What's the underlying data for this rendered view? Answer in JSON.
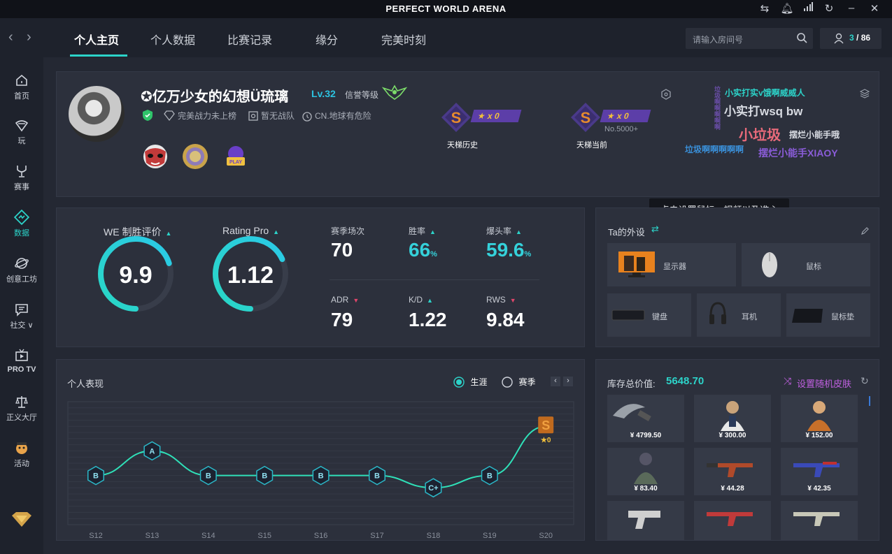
{
  "app": {
    "title": "PERFECT WORLD ARENA"
  },
  "nav": {
    "tabs": [
      "个人主页",
      "个人数据",
      "比赛记录",
      "缘分",
      "完美时刻"
    ],
    "search_placeholder": "请输入房间号",
    "online_current": "3",
    "online_total": "/ 86"
  },
  "sidebar": {
    "items": [
      {
        "label": "首页",
        "icon": "home-icon"
      },
      {
        "label": "玩",
        "icon": "play-icon"
      },
      {
        "label": "赛事",
        "icon": "trophy-icon"
      },
      {
        "label": "数据",
        "icon": "data-icon"
      },
      {
        "label": "创意工坊",
        "icon": "workshop-icon"
      },
      {
        "label": "社交 ∨",
        "icon": "social-icon"
      },
      {
        "label": "PRO TV",
        "icon": "tv-icon"
      },
      {
        "label": "正义大厅",
        "icon": "scales-icon"
      },
      {
        "label": "活动",
        "icon": "event-icon"
      }
    ]
  },
  "profile": {
    "name": "✪亿万少女的幻想Ü琉璃",
    "level": "Lv.32",
    "credit_label": "信誉等级",
    "tag_rank": "完美战力未上榜",
    "tag_team": "暂无战队",
    "tag_region": "CN.地球有危险",
    "ladder_history": {
      "grade": "S",
      "stars": "★ x 0",
      "label": "天梯历史"
    },
    "ladder_current": {
      "grade": "S",
      "stars": "★ x 0",
      "rank": "No.5000+",
      "label": "天梯当前"
    },
    "word_cloud": [
      "小实打实v饿啊威威人",
      "小实打wsq bw",
      "小垃圾",
      "摆烂小能手哦",
      "垃圾啊啊啊啊啊",
      "摆烂小能手XIAOY",
      "垃圾啊啊啊啊啊"
    ]
  },
  "tooltip": "点击设置鼠标、视频以及准心",
  "stats": {
    "we_label": "WE 制胜评价",
    "we_value": "9.9",
    "we_fraction": 0.7,
    "rating_label": "Rating Pro",
    "rating_value": "1.12",
    "rating_fraction": 0.68,
    "items": [
      {
        "label": "赛季场次",
        "value": "70",
        "unit": "",
        "trend": "",
        "teal": false
      },
      {
        "label": "胜率",
        "value": "66",
        "unit": "%",
        "trend": "up",
        "teal": true
      },
      {
        "label": "爆头率",
        "value": "59.6",
        "unit": "%",
        "trend": "up",
        "teal": true
      },
      {
        "label": "ADR",
        "value": "79",
        "unit": "",
        "trend": "down",
        "teal": false
      },
      {
        "label": "K/D",
        "value": "1.22",
        "unit": "",
        "trend": "up",
        "teal": false
      },
      {
        "label": "RWS",
        "value": "9.84",
        "unit": "",
        "trend": "down",
        "teal": false
      }
    ]
  },
  "gear": {
    "title": "Ta的外设",
    "items": [
      "显示器",
      "鼠标",
      "键盘",
      "耳机",
      "鼠标垫"
    ]
  },
  "performance": {
    "title": "个人表现",
    "radio_career": "生涯",
    "radio_season": "赛季"
  },
  "chart_data": {
    "type": "line",
    "categories": [
      "S12",
      "S13",
      "S14",
      "S15",
      "S16",
      "S17",
      "S18",
      "S19",
      "S20"
    ],
    "grades": [
      "B",
      "A",
      "B",
      "B",
      "B",
      "B",
      "C+",
      "B",
      "S"
    ],
    "values": [
      2,
      3,
      2,
      2,
      2,
      2,
      1.5,
      2,
      4
    ],
    "end_stars": "★0"
  },
  "inventory": {
    "label": "库存总价值:",
    "total": "5648.70",
    "random_skin": "设置随机皮肤",
    "items": [
      {
        "price": "¥ 4799.50",
        "kind": "knife"
      },
      {
        "price": "¥ 300.00",
        "kind": "agent"
      },
      {
        "price": "¥ 152.00",
        "kind": "agent2"
      },
      {
        "price": "¥ 83.40",
        "kind": "agent3"
      },
      {
        "price": "¥ 44.28",
        "kind": "rifle"
      },
      {
        "price": "¥ 42.35",
        "kind": "rifle2"
      },
      {
        "price": "",
        "kind": "pistol"
      },
      {
        "price": "",
        "kind": "rifle3"
      },
      {
        "price": "",
        "kind": "rifle4"
      }
    ]
  }
}
